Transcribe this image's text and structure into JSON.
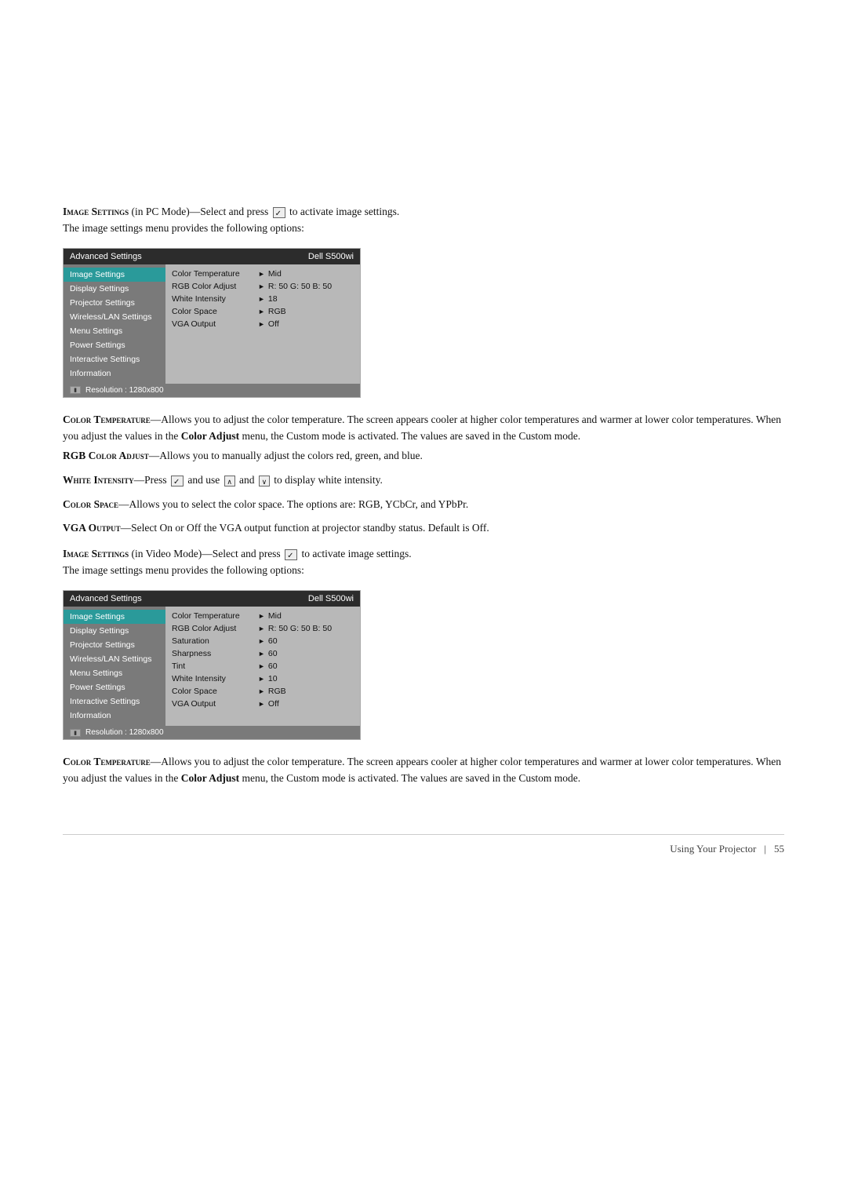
{
  "page": {
    "spacer_top": true
  },
  "section_pc": {
    "heading": "Image Settings (in PC Mode)",
    "heading_prefix": "Image Settings",
    "heading_mode": "(in PC Mode)",
    "intro": "—Select and press",
    "intro_after": "to activate image settings.",
    "intro2": "The image settings menu provides the following options:",
    "menu": {
      "title_left": "Advanced Settings",
      "title_right": "Dell S500wi",
      "sidebar_items": [
        {
          "label": "Image Settings",
          "active": true
        },
        {
          "label": "Display Settings",
          "active": false
        },
        {
          "label": "Projector Settings",
          "active": false
        },
        {
          "label": "Wireless/LAN Settings",
          "active": false
        },
        {
          "label": "Menu Settings",
          "active": false
        },
        {
          "label": "Power Settings",
          "active": false
        },
        {
          "label": "Interactive Settings",
          "active": false
        },
        {
          "label": "Information",
          "active": false
        }
      ],
      "rows": [
        {
          "label": "Color Temperature",
          "value": "Mid"
        },
        {
          "label": "RGB Color Adjust",
          "value": "R: 50 G: 50 B: 50"
        },
        {
          "label": "White Intensity",
          "value": "18"
        },
        {
          "label": "Color Space",
          "value": "RGB"
        },
        {
          "label": "VGA Output",
          "value": "Off"
        }
      ],
      "footer": "Resolution : 1280x800"
    }
  },
  "items_pc": [
    {
      "name": "color_temperature",
      "heading_prefix": "Color Temperature",
      "heading_label": "Color Temperature",
      "text": "—Allows you to adjust the color temperature. The screen appears cooler at higher color temperatures and warmer at lower color temperatures. When you adjust the values in the",
      "bold_word": "Color Adjust",
      "text_after": "menu, the Custom mode is activated. The values are saved in the Custom mode."
    },
    {
      "name": "rgb_color_adjust",
      "heading_prefix": "RGB Color Adjust",
      "heading_label": "RGB Color Adjust",
      "text": "—Allows you to manually adjust the colors red, green, and blue."
    },
    {
      "name": "white_intensity",
      "heading_prefix": "White Intensity",
      "heading_label": "White Intensity",
      "text_before": "—Press",
      "text_mid": "and use",
      "text_and": "and",
      "text_after": "to display white intensity."
    },
    {
      "name": "color_space",
      "heading_prefix": "Color Space",
      "heading_label": "Color Space",
      "text": "—Allows you to select the color space. The options are: RGB, YCbCr, and YPbPr."
    },
    {
      "name": "vga_output",
      "heading_prefix": "VGA Output",
      "heading_label": "VGA Output",
      "text": "—Select On or Off the VGA output function at projector standby status. Default is Off."
    }
  ],
  "section_video": {
    "heading": "Image Settings (in Video Mode)",
    "heading_prefix": "Image Settings",
    "heading_mode": "(in Video Mode)",
    "intro": "—Select and press",
    "intro_after": "to activate image settings.",
    "intro2": "The image settings menu provides the following options:",
    "menu": {
      "title_left": "Advanced Settings",
      "title_right": "Dell S500wi",
      "sidebar_items": [
        {
          "label": "Image Settings",
          "active": true
        },
        {
          "label": "Display Settings",
          "active": false
        },
        {
          "label": "Projector Settings",
          "active": false
        },
        {
          "label": "Wireless/LAN Settings",
          "active": false
        },
        {
          "label": "Menu Settings",
          "active": false
        },
        {
          "label": "Power Settings",
          "active": false
        },
        {
          "label": "Interactive Settings",
          "active": false
        },
        {
          "label": "Information",
          "active": false
        }
      ],
      "rows": [
        {
          "label": "Color Temperature",
          "value": "Mid"
        },
        {
          "label": "RGB Color Adjust",
          "value": "R: 50 G: 50 B: 50"
        },
        {
          "label": "Saturation",
          "value": "60"
        },
        {
          "label": "Sharpness",
          "value": "60"
        },
        {
          "label": "Tint",
          "value": "60"
        },
        {
          "label": "White Intensity",
          "value": "10"
        },
        {
          "label": "Color Space",
          "value": "RGB"
        },
        {
          "label": "VGA Output",
          "value": "Off"
        }
      ],
      "footer": "Resolution : 1280x800"
    }
  },
  "items_video": [
    {
      "name": "color_temperature_video",
      "heading_prefix": "Color Temperature",
      "heading_label": "Color Temperature",
      "text": "—Allows you to adjust the color temperature. The screen appears cooler at higher color temperatures and warmer at lower color temperatures. When you adjust the values in the",
      "bold_word": "Color Adjust",
      "text_after": "menu, the Custom mode is activated. The values are saved in the Custom mode."
    }
  ],
  "footer": {
    "text": "Using Your Projector",
    "divider": "|",
    "page_number": "55"
  }
}
